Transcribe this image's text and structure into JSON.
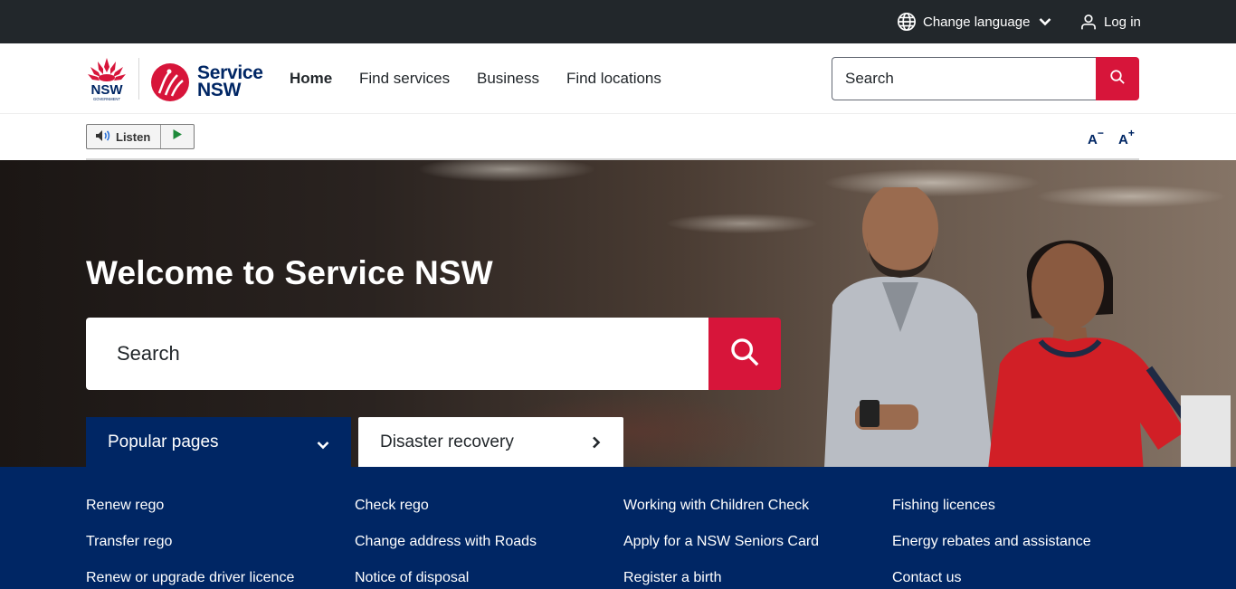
{
  "utility": {
    "change_language": "Change language",
    "log_in": "Log in"
  },
  "header": {
    "logo_nsw_text": "NSW",
    "logo_gov_text": "GOVERNMENT",
    "logo_service_line1": "Service",
    "logo_service_line2": "NSW",
    "nav": {
      "home": "Home",
      "find_services": "Find services",
      "business": "Business",
      "find_locations": "Find locations"
    },
    "search_placeholder": "Search"
  },
  "listen": {
    "label": "Listen"
  },
  "text_size": {
    "smaller": "A",
    "smaller_sign": "−",
    "larger": "A",
    "larger_sign": "+"
  },
  "hero": {
    "title": "Welcome to Service NSW",
    "search_placeholder": "Search",
    "tabs": {
      "popular": "Popular pages",
      "disaster": "Disaster recovery"
    }
  },
  "popular_links": {
    "col1": [
      "Renew rego",
      "Transfer rego",
      "Renew or upgrade driver licence"
    ],
    "col2": [
      "Check rego",
      "Change address with Roads",
      "Notice of disposal"
    ],
    "col3": [
      "Working with Children Check",
      "Apply for a NSW Seniors Card",
      "Register a birth"
    ],
    "col4": [
      "Fishing licences",
      "Energy rebates and assistance",
      "Contact us"
    ]
  },
  "colors": {
    "nsw_navy": "#002664",
    "nsw_red": "#d7153a",
    "utility_bar": "#22272b"
  }
}
